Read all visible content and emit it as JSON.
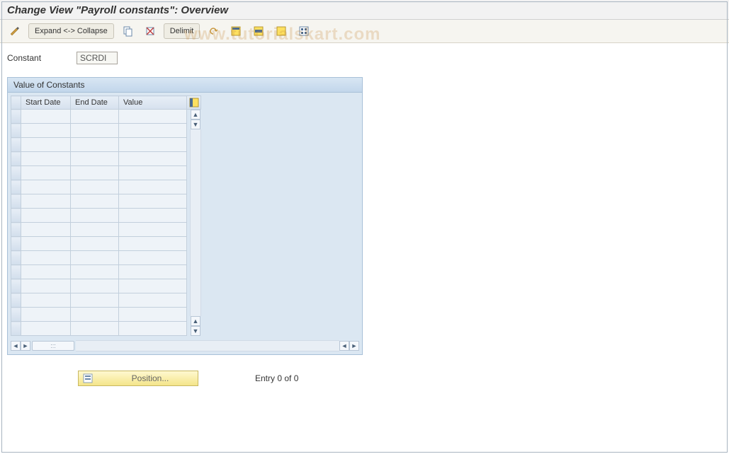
{
  "title": "Change View \"Payroll constants\": Overview",
  "toolbar": {
    "expand_collapse_label": "Expand <-> Collapse",
    "delimit_label": "Delimit"
  },
  "filter": {
    "constant_label": "Constant",
    "constant_value": "SCRDI"
  },
  "panel": {
    "title": "Value of Constants",
    "columns": {
      "start_date": "Start Date",
      "end_date": "End Date",
      "value": "Value"
    },
    "rows": [
      {
        "start": "",
        "end": "",
        "value": ""
      },
      {
        "start": "",
        "end": "",
        "value": ""
      },
      {
        "start": "",
        "end": "",
        "value": ""
      },
      {
        "start": "",
        "end": "",
        "value": ""
      },
      {
        "start": "",
        "end": "",
        "value": ""
      },
      {
        "start": "",
        "end": "",
        "value": ""
      },
      {
        "start": "",
        "end": "",
        "value": ""
      },
      {
        "start": "",
        "end": "",
        "value": ""
      },
      {
        "start": "",
        "end": "",
        "value": ""
      },
      {
        "start": "",
        "end": "",
        "value": ""
      },
      {
        "start": "",
        "end": "",
        "value": ""
      },
      {
        "start": "",
        "end": "",
        "value": ""
      },
      {
        "start": "",
        "end": "",
        "value": ""
      },
      {
        "start": "",
        "end": "",
        "value": ""
      },
      {
        "start": "",
        "end": "",
        "value": ""
      },
      {
        "start": "",
        "end": "",
        "value": ""
      }
    ]
  },
  "footer": {
    "position_label": "Position...",
    "entry_status": "Entry 0 of 0"
  },
  "watermark": "www.tutorialskart.com"
}
